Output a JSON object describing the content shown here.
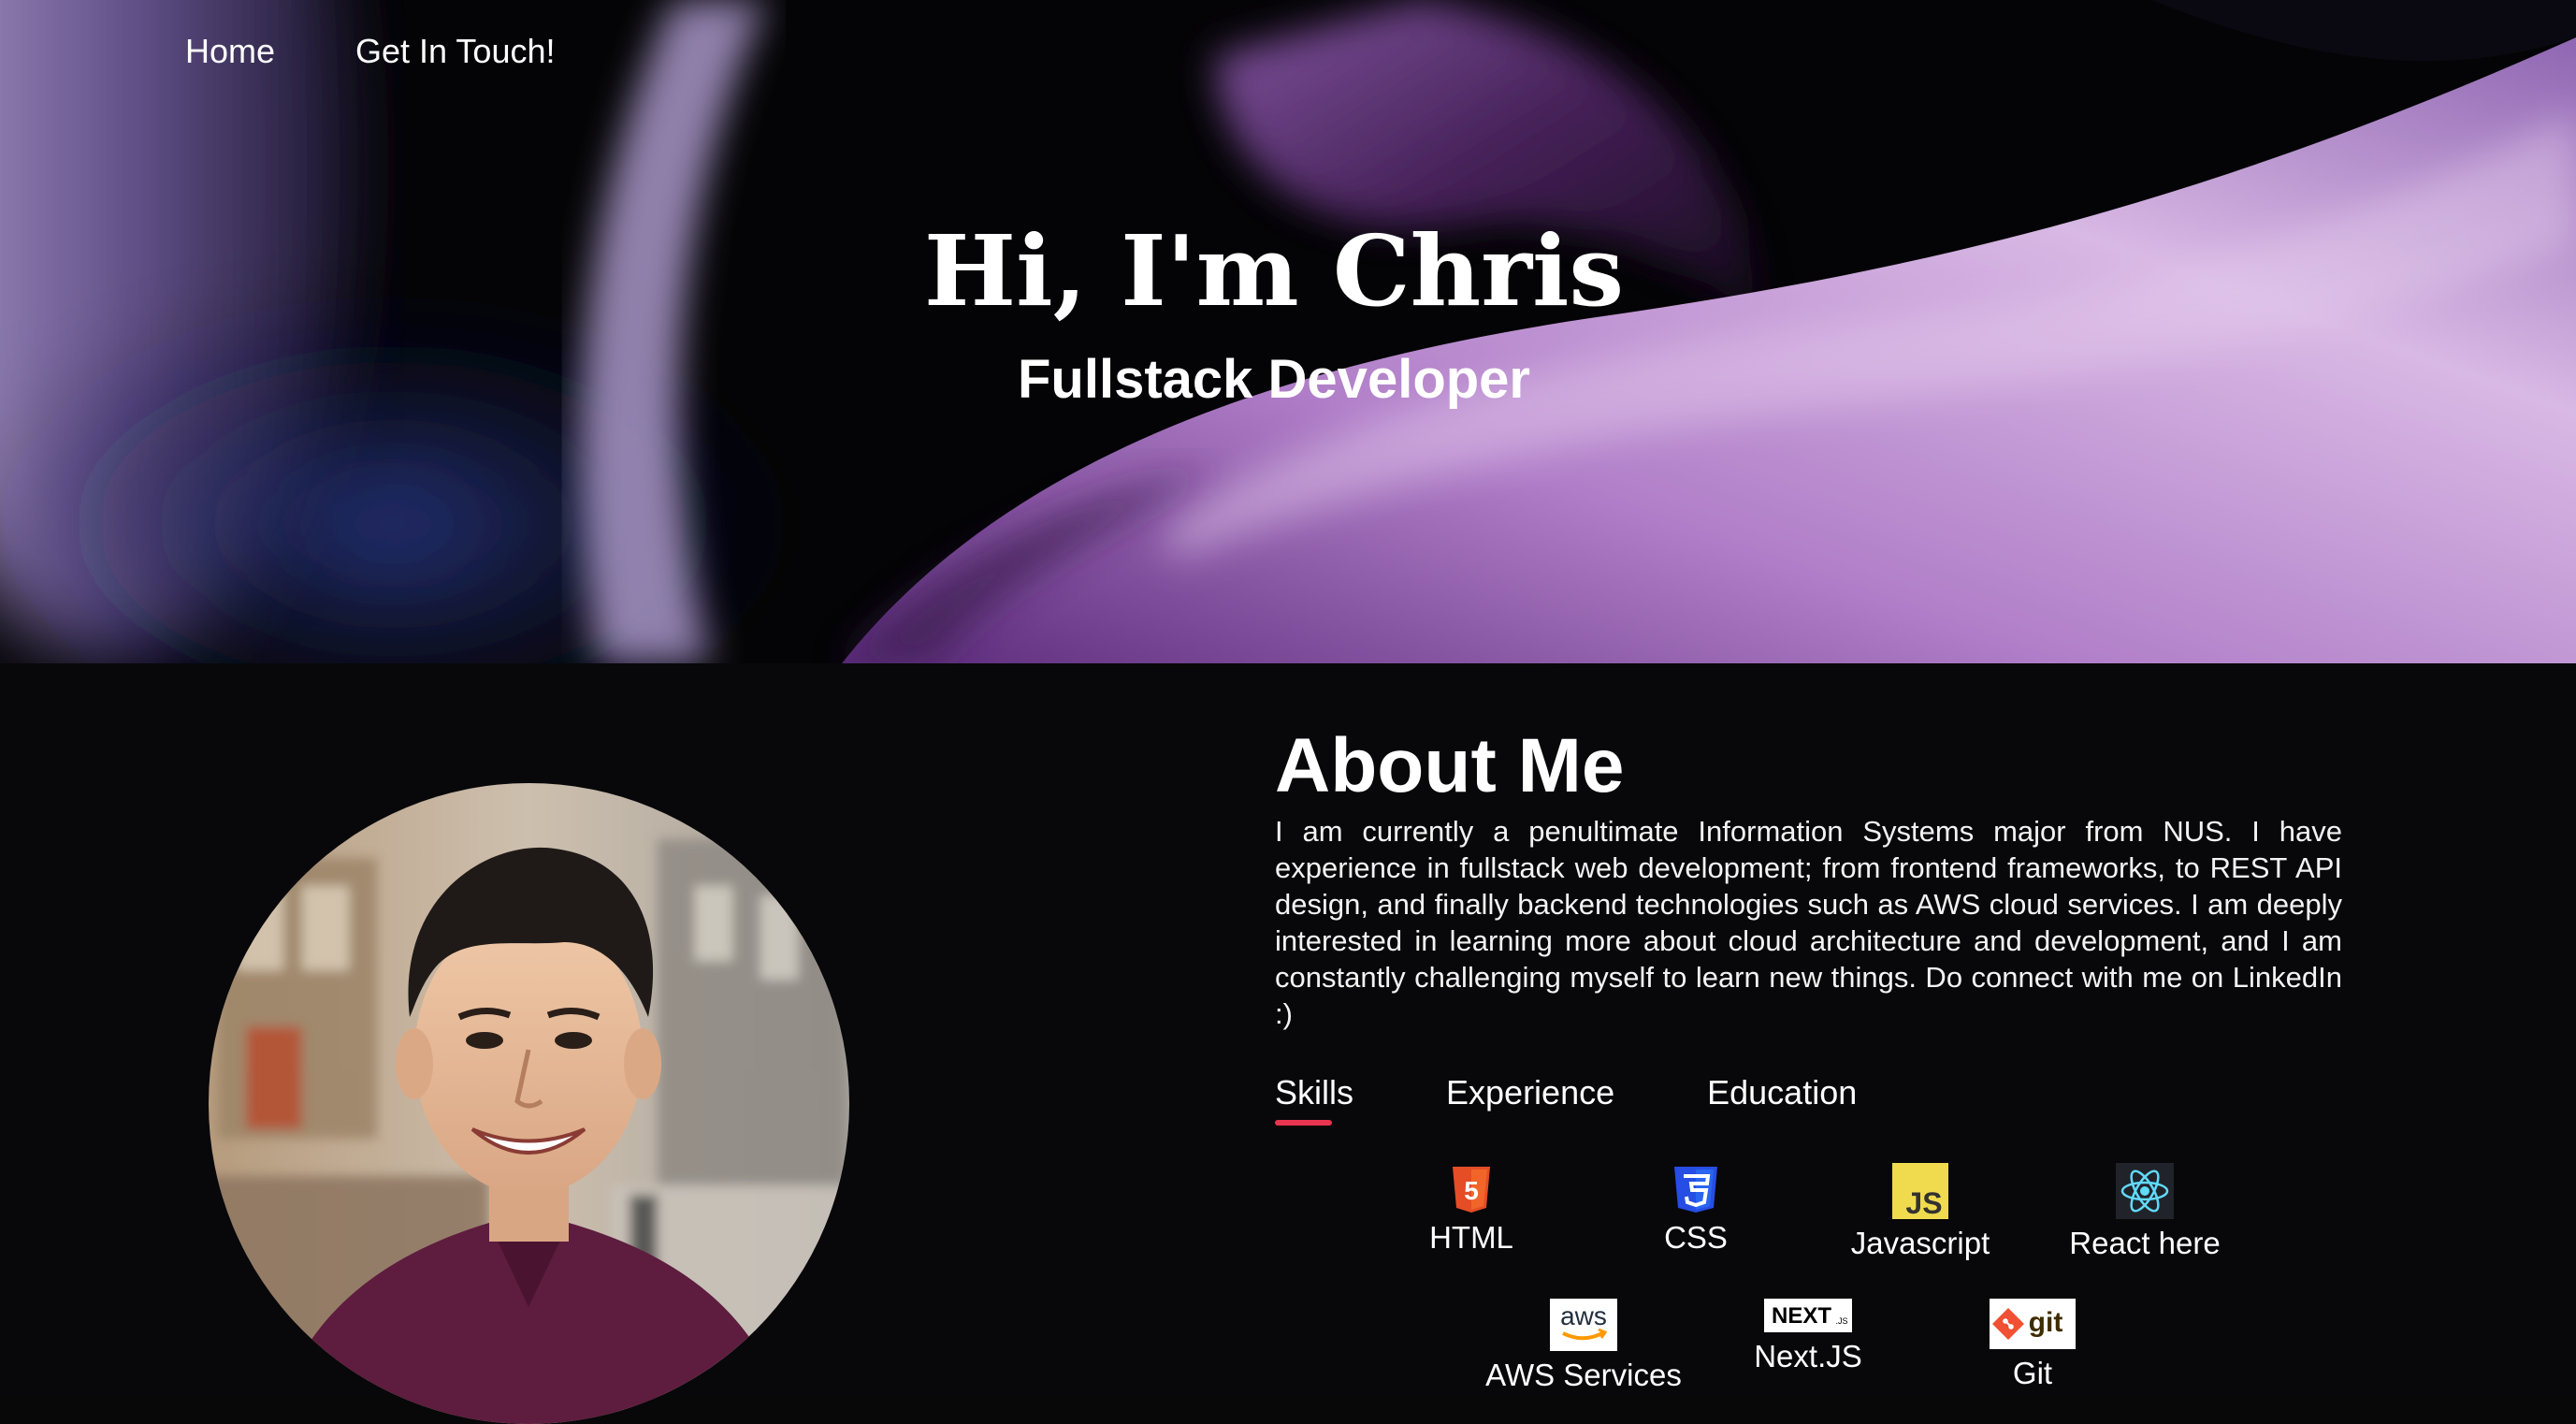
{
  "nav": {
    "items": [
      {
        "label": "Home"
      },
      {
        "label": "Get In Touch!"
      }
    ]
  },
  "hero": {
    "title": "Hi, I'm Chris",
    "subtitle": "Fullstack Developer"
  },
  "about": {
    "title": "About Me",
    "text": "I am currently a penultimate Information Systems major from NUS. I have experience in fullstack web development; from frontend frameworks, to REST API design, and finally backend technologies such as AWS cloud services. I am deeply interested in learning more about cloud architecture and development, and I am constantly challenging myself to learn new things. Do connect with me on LinkedIn :)",
    "tabs": [
      {
        "label": "Skills",
        "active": true
      },
      {
        "label": "Experience",
        "active": false
      },
      {
        "label": "Education",
        "active": false
      }
    ],
    "skills": [
      {
        "label": "HTML",
        "icon": "html5-icon"
      },
      {
        "label": "CSS",
        "icon": "css3-icon"
      },
      {
        "label": "Javascript",
        "icon": "javascript-icon"
      },
      {
        "label": "React here",
        "icon": "react-icon"
      },
      {
        "label": "AWS Services",
        "icon": "aws-icon"
      },
      {
        "label": "Next.JS",
        "icon": "nextjs-icon"
      },
      {
        "label": "Git",
        "icon": "git-icon"
      }
    ],
    "icon_text": {
      "html_badge": "5",
      "css_badge": "3",
      "js_badge": "JS",
      "aws_badge": "aws",
      "next_badge": "NEXT",
      "next_sub": ".JS",
      "git_badge": "git"
    }
  },
  "colors": {
    "accent": "#e8344f",
    "background": "#08080a",
    "hero_purple": "#b58ed0"
  }
}
